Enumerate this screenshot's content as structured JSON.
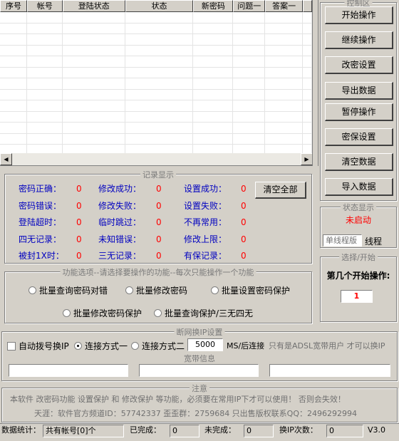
{
  "table": {
    "columns": [
      "序号",
      "帐号",
      "登陆状态",
      "状态",
      "新密码",
      "问题一",
      "答案一",
      ""
    ],
    "rows": 13
  },
  "control_panel": {
    "title": "控制区",
    "buttons": [
      "开始操作",
      "继续操作",
      "改密设置",
      "导出数据",
      "暂停操作",
      "密保设置",
      "清空数据",
      "导入数据"
    ]
  },
  "status_panel": {
    "title": "状态显示",
    "status": "未启动",
    "thread_input": "单线程版",
    "thread_label": "线程"
  },
  "start_panel": {
    "title": "选择/开始",
    "label": "第几个开始操作:",
    "value": "1"
  },
  "records": {
    "title": "记录显示",
    "clear_button": "清空全部",
    "items": [
      {
        "label": "密码正确：",
        "value": "0"
      },
      {
        "label": "修改成功：",
        "value": "0"
      },
      {
        "label": "设置成功：",
        "value": "0"
      },
      {
        "label": "密码错误：",
        "value": "0"
      },
      {
        "label": "修改失败：",
        "value": "0"
      },
      {
        "label": "设置失败：",
        "value": "0"
      },
      {
        "label": "登陆超时：",
        "value": "0"
      },
      {
        "label": "临时跳过：",
        "value": "0"
      },
      {
        "label": "不再常用：",
        "value": "0"
      },
      {
        "label": "四无记录：",
        "value": "0"
      },
      {
        "label": "未知错误：",
        "value": "0"
      },
      {
        "label": "修改上限：",
        "value": "0"
      },
      {
        "label": "被封1X时：",
        "value": "0"
      },
      {
        "label": "三无记录：",
        "value": "0"
      },
      {
        "label": "有保记录：",
        "value": "0"
      }
    ]
  },
  "functions": {
    "title": "功能选项--请选择要操作的功能--每次只能操作一个功能",
    "options": [
      "批量查询密码对错",
      "批量修改密码",
      "批量设置密码保护",
      "批量修改密码保护",
      "批量查询保护/三无四无"
    ]
  },
  "network": {
    "title": "断网换IP设置",
    "auto_dial": "自动拨号换IP",
    "mode1": "连接方式一",
    "mode2": "连接方式二",
    "delay_value": "5000",
    "delay_unit": "MS/后连接",
    "hint": "只有是ADSL宽带用户 才可以换IP"
  },
  "broadband": {
    "title": "宽带信息",
    "field1": "",
    "field2": "",
    "field3": ""
  },
  "notice": {
    "title": "注意",
    "line1": "本软件 改密码功能 设置保护 和 修改保护 等功能，必须要在常用IP下才可以使用！ 否则会失效！",
    "line2": "天涯：软件官方频道ID：57742337  歪歪群：2759684 只出售版权联系QQ：2496292994"
  },
  "statusbar": {
    "label": "数据统计：",
    "total": "共有帐号[0]个",
    "done_label": "已完成：",
    "done_value": "0",
    "undone_label": "未完成：",
    "undone_value": "0",
    "ip_label": "换IP次数：",
    "ip_value": "0",
    "version": "V3.0"
  },
  "colors": {
    "window_bg": "#d4d0c8",
    "label_blue": "#0000c0",
    "value_red": "#ff0000"
  }
}
